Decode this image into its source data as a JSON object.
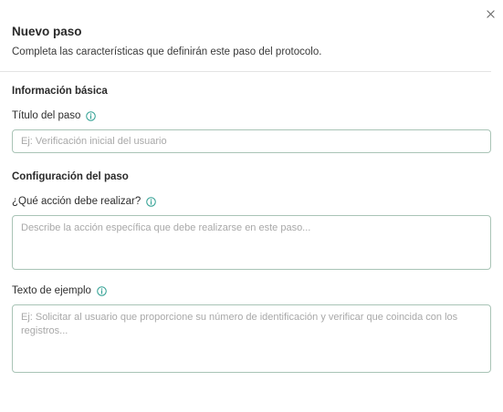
{
  "dialog": {
    "title": "Nuevo paso",
    "subtitle": "Completa las características que definirán este paso del protocolo.",
    "close_icon": "close-icon"
  },
  "basic_info": {
    "section_title": "Información básica",
    "step_title_label": "Título del paso",
    "step_title_placeholder": "Ej: Verificación inicial del usuario",
    "step_title_value": ""
  },
  "step_config": {
    "section_title": "Configuración del paso",
    "action_label": "¿Qué acción debe realizar?",
    "action_placeholder": "Describe la acción específica que debe realizarse en este paso...",
    "action_value": "",
    "example_label": "Texto de ejemplo",
    "example_placeholder": "Ej: Solicitar al usuario que proporcione su número de identificación y verificar que coincida con los registros...",
    "example_value": ""
  },
  "colors": {
    "accent": "#2a9d8f",
    "input_border": "#a9c4b6"
  }
}
